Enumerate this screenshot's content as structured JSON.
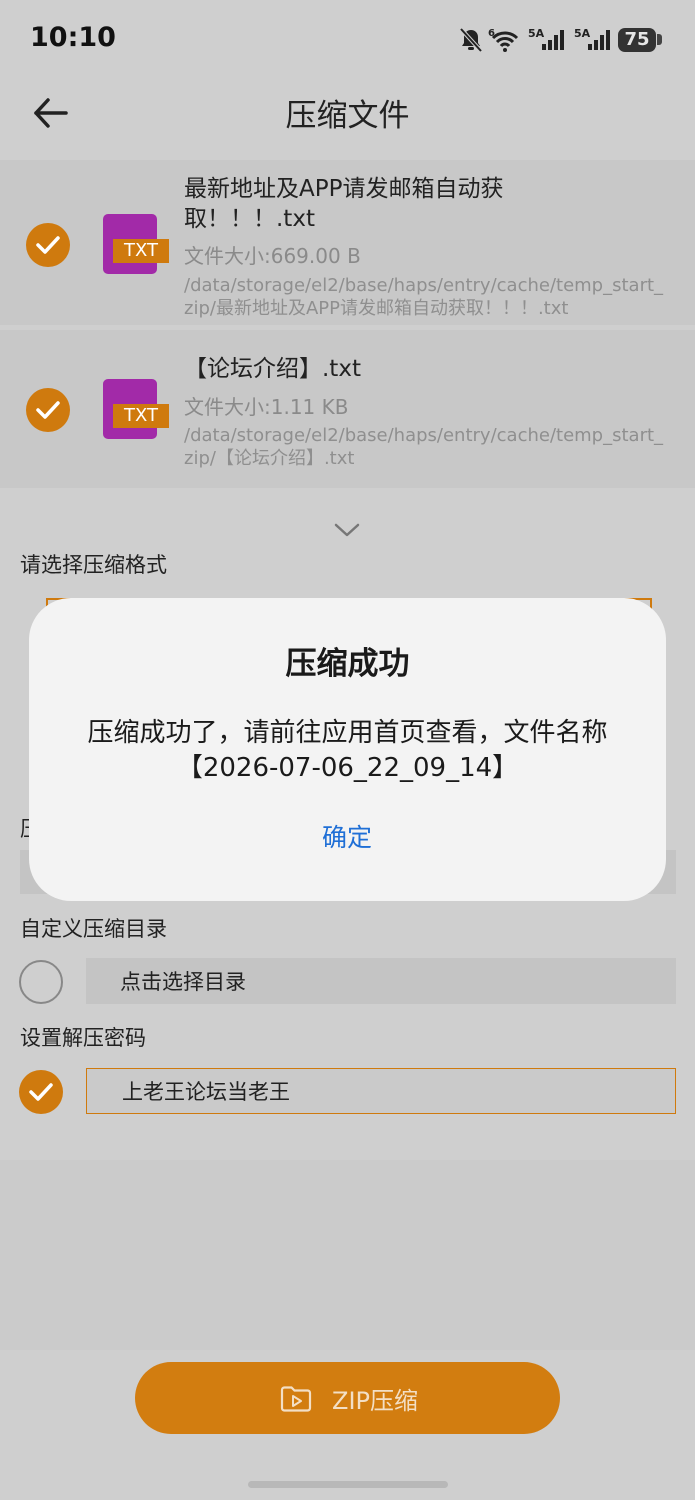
{
  "status_bar": {
    "time": "10:10",
    "battery": "75",
    "signal_label_1": "5A",
    "signal_label_2": "5A",
    "wifi_label": "6"
  },
  "header": {
    "title": "压缩文件"
  },
  "files": [
    {
      "name": "最新地址及APP请发邮箱自动获取！！！.txt",
      "size": "文件大小:669.00 B",
      "path": "/data/storage/el2/base/haps/entry/cache/temp_start_zip/最新地址及APP请发邮箱自动获取！！！.txt",
      "type_label": "TXT"
    },
    {
      "name": "【论坛介绍】.txt",
      "size": "文件大小:1.11 KB",
      "path": "/data/storage/el2/base/haps/entry/cache/temp_start_zip/【论坛介绍】.txt",
      "type_label": "TXT"
    }
  ],
  "options": {
    "format_label": "请选择压缩格式",
    "hidden_label_partial": "压",
    "custom_dir_label": "自定义压缩目录",
    "custom_dir_placeholder": "点击选择目录",
    "password_label": "设置解压密码",
    "password_value": "上老王论坛当老王"
  },
  "zip_button": {
    "label": "ZIP压缩"
  },
  "dialog": {
    "title": "压缩成功",
    "message": "压缩成功了，请前往应用首页查看，文件名称【2026-07-06_22_09_14】",
    "confirm_label": "确定"
  },
  "colors": {
    "accent": "#cf7a0e",
    "link": "#1f6fd6",
    "file_icon": "#a22aa8"
  }
}
